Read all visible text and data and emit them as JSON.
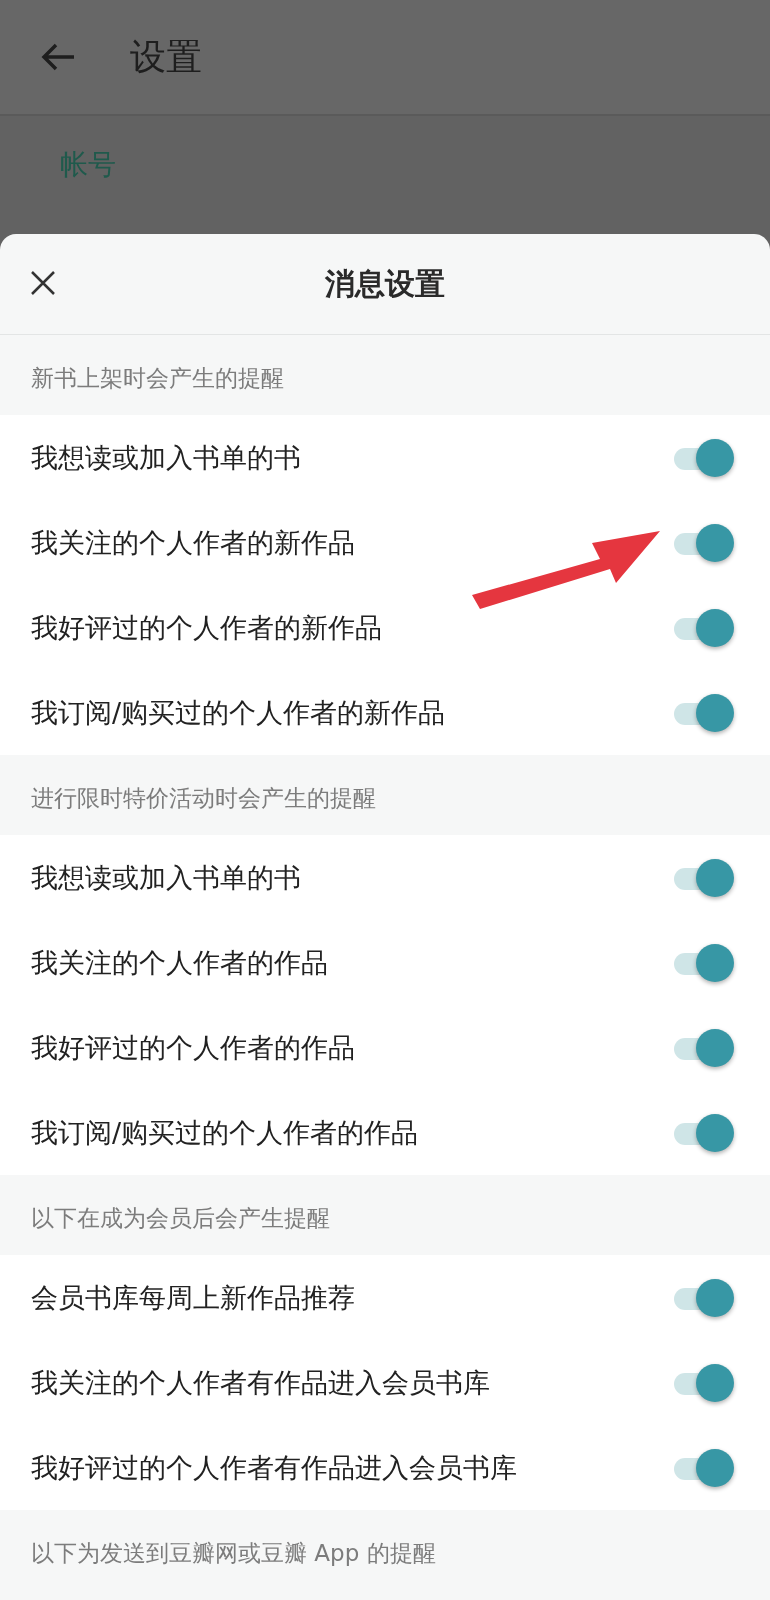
{
  "background_page": {
    "title": "设置",
    "section_label": "帐号"
  },
  "sheet": {
    "title": "消息设置",
    "sections": [
      {
        "header": "新书上架时会产生的提醒",
        "items": [
          {
            "label": "我想读或加入书单的书",
            "on": true
          },
          {
            "label": "我关注的个人作者的新作品",
            "on": true
          },
          {
            "label": "我好评过的个人作者的新作品",
            "on": true
          },
          {
            "label": "我订阅/购买过的个人作者的新作品",
            "on": true
          }
        ]
      },
      {
        "header": "进行限时特价活动时会产生的提醒",
        "items": [
          {
            "label": "我想读或加入书单的书",
            "on": true
          },
          {
            "label": "我关注的个人作者的作品",
            "on": true
          },
          {
            "label": "我好评过的个人作者的作品",
            "on": true
          },
          {
            "label": "我订阅/购买过的个人作者的作品",
            "on": true
          }
        ]
      },
      {
        "header": "以下在成为会员后会产生提醒",
        "items": [
          {
            "label": "会员书库每周上新作品推荐",
            "on": true
          },
          {
            "label": "我关注的个人作者有作品进入会员书库",
            "on": true
          },
          {
            "label": "我好评过的个人作者有作品进入会员书库",
            "on": true
          }
        ]
      },
      {
        "header": "以下为发送到豆瓣网或豆瓣 App 的提醒"
      }
    ]
  }
}
